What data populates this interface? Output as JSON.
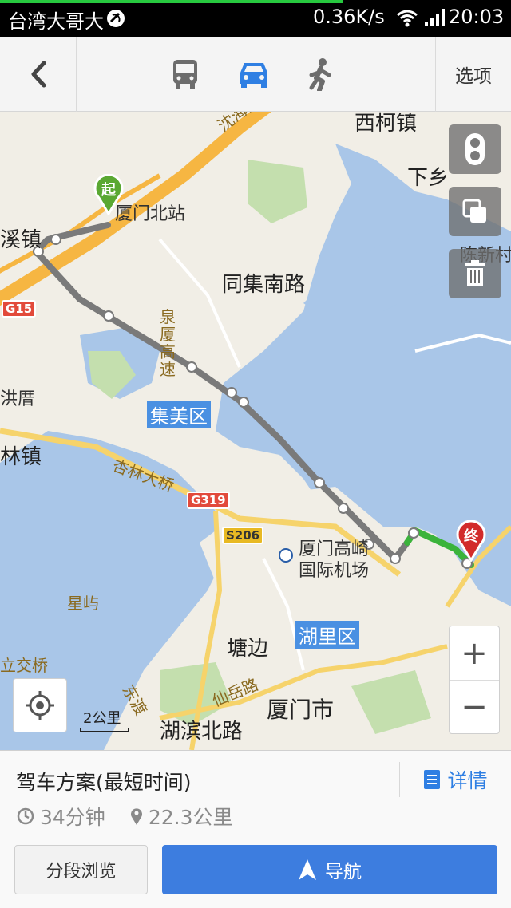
{
  "status_bar": {
    "carrier": "台湾大哥大",
    "speed": "0.36K/s",
    "time": "20:03"
  },
  "toolbar": {
    "back_icon": "chevron-left-icon",
    "modes": [
      {
        "name": "bus",
        "icon": "bus-icon",
        "active": false
      },
      {
        "name": "car",
        "icon": "car-icon",
        "active": true
      },
      {
        "name": "walk",
        "icon": "walk-icon",
        "active": false
      }
    ],
    "options_label": "选项",
    "active_color": "#2f7fe3",
    "inactive_color": "#6c6c6c"
  },
  "map": {
    "labels": {
      "xike": "西柯镇",
      "xiaxiang": "下乡",
      "xiamen_north": "厦门北站",
      "xizhen": "溪镇",
      "chenxincun": "陈新村",
      "tongji_south": "同集南路",
      "hongcuo": "洪厝",
      "jimei": "集美区",
      "linzhen": "林镇",
      "xinglin_bridge": "杏林大桥",
      "airport": "厦门高崎",
      "airport2": "国际机场",
      "xingyu": "星屿",
      "huli": "湖里区",
      "tangbian": "塘边",
      "lijiaoqiao": "立交桥",
      "xianyue": "仙岳路",
      "hubin_north": "湖滨北路",
      "xiamen_city": "厦门市",
      "shenhai": "沈海高",
      "quanxia": "泉厦高速",
      "dongdu": "东渡",
      "shields": {
        "g15": "G15",
        "g319": "G319",
        "s206": "S206"
      }
    },
    "start_label": "起",
    "end_label": "终",
    "scale_label": "2公里",
    "zoom_in": "+",
    "zoom_out": "−",
    "route_color": "#7a7a7a",
    "route_end_color": "#3bb33b",
    "water_color": "#a9c6e8",
    "green_color": "#c4dfae"
  },
  "panel": {
    "plan_title": "驾车方案(最短时间)",
    "detail_label": "详情",
    "duration": "34分钟",
    "distance": "22.3公里",
    "segment_button": "分段浏览",
    "navigate_button": "导航",
    "accent_color": "#3d7ddf"
  }
}
